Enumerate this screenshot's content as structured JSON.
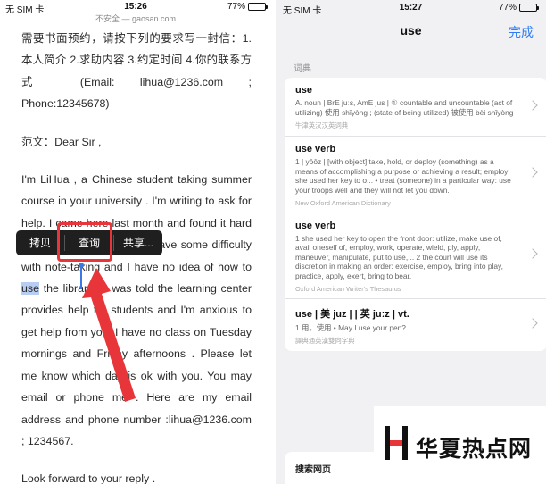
{
  "left": {
    "status": {
      "carrier": "无 SIM 卡",
      "time": "15:26",
      "battery": "77%"
    },
    "url": "不安全 — gaosan.com",
    "paragraphs": [
      "需要书面预约，请按下列的要求写一封信：1.本人简介 2.求助内容 3.约定时间 4.你的联系方式 (Email: lihua@1236.com ; Phone:12345678)",
      "范文：Dear Sir ,",
      "I'm LiHua , a Chinese student taking summer course in your university . I'm writing to ask for help. I came here last month and found it hard to follow the lecture, but I have some difficulty with note-taking and I have no idea of how to ",
      "Look forward to your reply ."
    ],
    "highlight_word": "use",
    "para3_tail": " the library . I was told the learning center provides help for students and I'm anxious to get help from you. I have no class on Tuesday mornings and Friday afternoons . Please let me know which day is ok with you. You may email or phone me . Here are my email address and phone number :lihua@1236.com ; 1234567.",
    "popup": {
      "copy": "拷贝",
      "lookup": "查询",
      "share": "共享..."
    }
  },
  "right": {
    "status": {
      "carrier": "无 SIM 卡",
      "time": "15:27",
      "battery": "77%"
    },
    "title": "use",
    "done": "完成",
    "section": "词典",
    "entries": [
      {
        "head": "use",
        "body": "A. noun | BrE juːs, AmE jus | ① countable and uncountable (act of utilizing) 使用 shǐyòng ; (state of being utilized) 被使用 bèi shǐyòng",
        "source": "牛津英汉汉英词典"
      },
      {
        "head": "use verb",
        "body": "1 | yōōz | [with object] take, hold, or deploy (something) as a means of accomplishing a purpose or achieving a result; employ: she used her key to o... • treat (someone) in a particular way: use your troops well and they will not let you down.",
        "source": "New Oxford American Dictionary"
      },
      {
        "head": "use verb",
        "body": "1 she used her key to open the front door: utilize, make use of, avail oneself of, employ, work, operate, wield, ply, apply, maneuver, manipulate, put to use,... 2 the court will use its discretion in making an order: exercise, employ, bring into play, practice, apply, exert, bring to bear.",
        "source": "Oxford American Writer's Thesaurus"
      },
      {
        "head": "use | 美 juz | | 英 juːz | vt.",
        "body": "1 用。使用 • May I use your pen?",
        "source": "譯典通英漢雙向字典"
      }
    ],
    "web_label": "搜索网页"
  },
  "watermark": {
    "text": "华夏热点网"
  },
  "colors": {
    "accent": "#2f7cf6",
    "annotation": "#e8353a",
    "selection": "#b7cdf2"
  }
}
